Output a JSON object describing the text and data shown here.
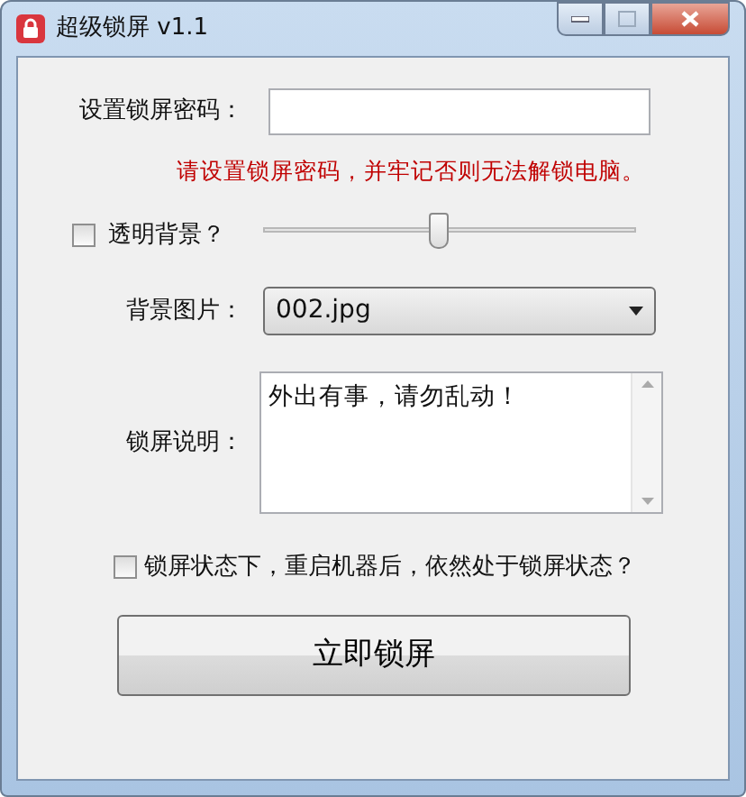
{
  "window": {
    "title": "超级锁屏 v1.1"
  },
  "password": {
    "label": "设置锁屏密码："
  },
  "hint": "请设置锁屏密码，并牢记否则无法解锁电脑。",
  "transparent": {
    "label": "透明背景？",
    "checked": false,
    "level": 0.47
  },
  "background": {
    "label": "背景图片：",
    "value": "002.jpg"
  },
  "note": {
    "label": "锁屏说明：",
    "value": "外出有事，请勿乱动！"
  },
  "persist": {
    "label": "锁屏状态下，重启机器后，依然处于锁屏状态？",
    "checked": false
  },
  "lock_button": "立即锁屏"
}
